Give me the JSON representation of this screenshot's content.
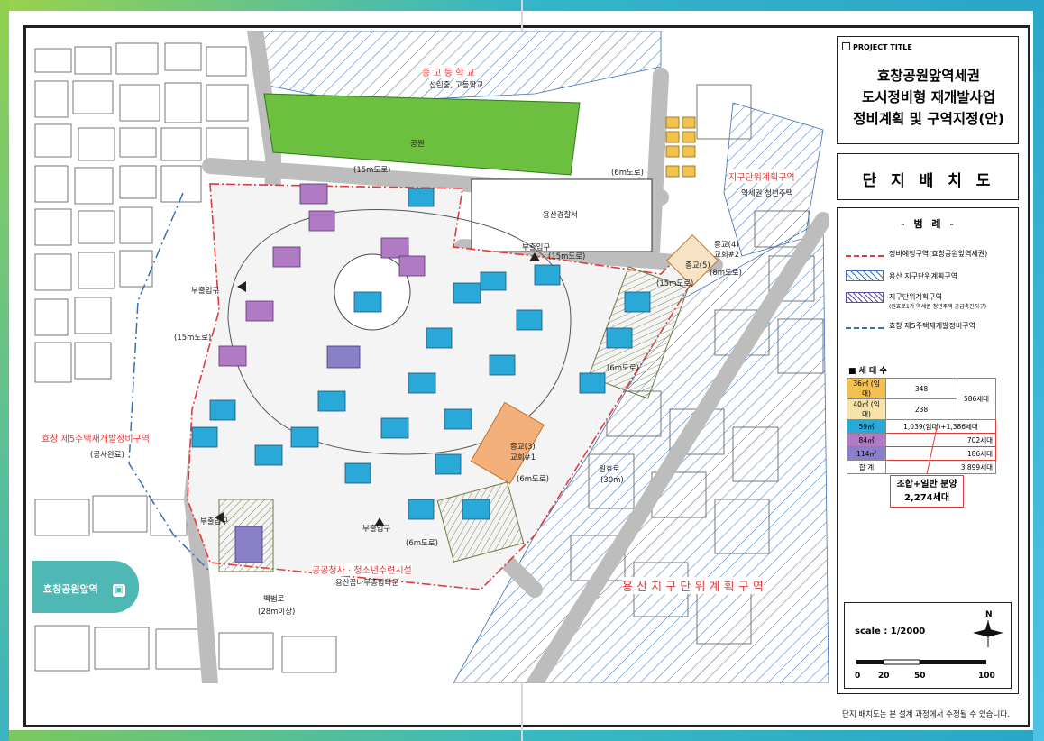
{
  "project_tag": "PROJECT TITLE",
  "project_title": [
    "효창공원앞역세권",
    "도시정비형 재개발사업",
    "정비계획 및 구역지정(안)"
  ],
  "drawing_title": "단 지 배 치 도",
  "legend": {
    "title": "- 범 례 -",
    "items": [
      {
        "label": "정비예정구역(효창공원앞역세권)",
        "symbol": "red-dash-line"
      },
      {
        "label": "용산 지구단위계획구역",
        "symbol": "blue-hatch"
      },
      {
        "label": "지구단위계획구역",
        "sub": "(원효로1가 역세권 청년주택 공급촉진지구)",
        "symbol": "purple-hatch"
      },
      {
        "label": "효창 제5주택재개발정비구역",
        "symbol": "blue-dash-line"
      }
    ]
  },
  "units": {
    "title": "세 대 수",
    "rows": [
      {
        "type": "36㎡ (임대)",
        "count": "348",
        "group": "586세대",
        "color": "#f2c14e"
      },
      {
        "type": "40㎡ (임대)",
        "count": "238",
        "group": "",
        "color": "#f7e3a8"
      },
      {
        "type": "59㎡",
        "count": "1,039(임대)+1,386세대",
        "group": "",
        "color": "#29a9d8"
      },
      {
        "type": "84㎡",
        "count": "702세대",
        "group": "",
        "color": "#b07ac4"
      },
      {
        "type": "114㎡",
        "count": "186세대",
        "group": "",
        "color": "#8a80c8"
      },
      {
        "type": "합 계",
        "count": "3,899세대",
        "group": "",
        "color": "#ffffff"
      }
    ],
    "callout": [
      "조합+일반 분양",
      "2,274세대"
    ]
  },
  "scale": {
    "label": "scale : 1/2000",
    "ticks": [
      "0",
      "20",
      "50",
      "100"
    ],
    "north": "N"
  },
  "disclaimer": "단지 배치도는 본 설계 과정에서 수정될 수 있습니다.",
  "map_labels": {
    "school": "중 고 등 학 교",
    "school_names": "선린중, 고등학교",
    "park": "공원",
    "road_15m_top": "(15m도로)",
    "road_15m_mid": "(15m도로)",
    "road_15m_right": "(15m도로)",
    "road_15m_left": "(15m도로)",
    "road_6m_top": "(6m도로)",
    "road_6m_mid": "(6m도로)",
    "road_6m_bottom": "(6m도로)",
    "road_6m_right": "(6m도로)",
    "road_8m": "(8m도로)",
    "police": "용산경찰서",
    "youth_district": "지구단위계획구역",
    "youth_housing": "역세권 청년주택",
    "religion_4": "종교(4)",
    "religion_5": "종교(5)",
    "church_2": "교회#2",
    "church_3": "종교(3)",
    "church_1": "교회#1",
    "entrance_1": "부출입구",
    "entrance_2": "부출입구",
    "entrance_3": "부출입구",
    "entrance_4": "부출입구",
    "redev_zone": "효창 제5주택재개발정비구역",
    "redev_status": "(공사완료)",
    "public_office": "공공청사 · 청소년수련시설",
    "yongsan_youth": "용산꿈나무종합타운",
    "wonhyo_road": "원효로",
    "wonhyo_width": "(30m)",
    "baekbeom_road": "백범로",
    "baekbeom_width": "(28m이상)",
    "yongsan_district": "용 산 지 구 단 위 계 획 구 역",
    "station": "효창공원앞역"
  }
}
